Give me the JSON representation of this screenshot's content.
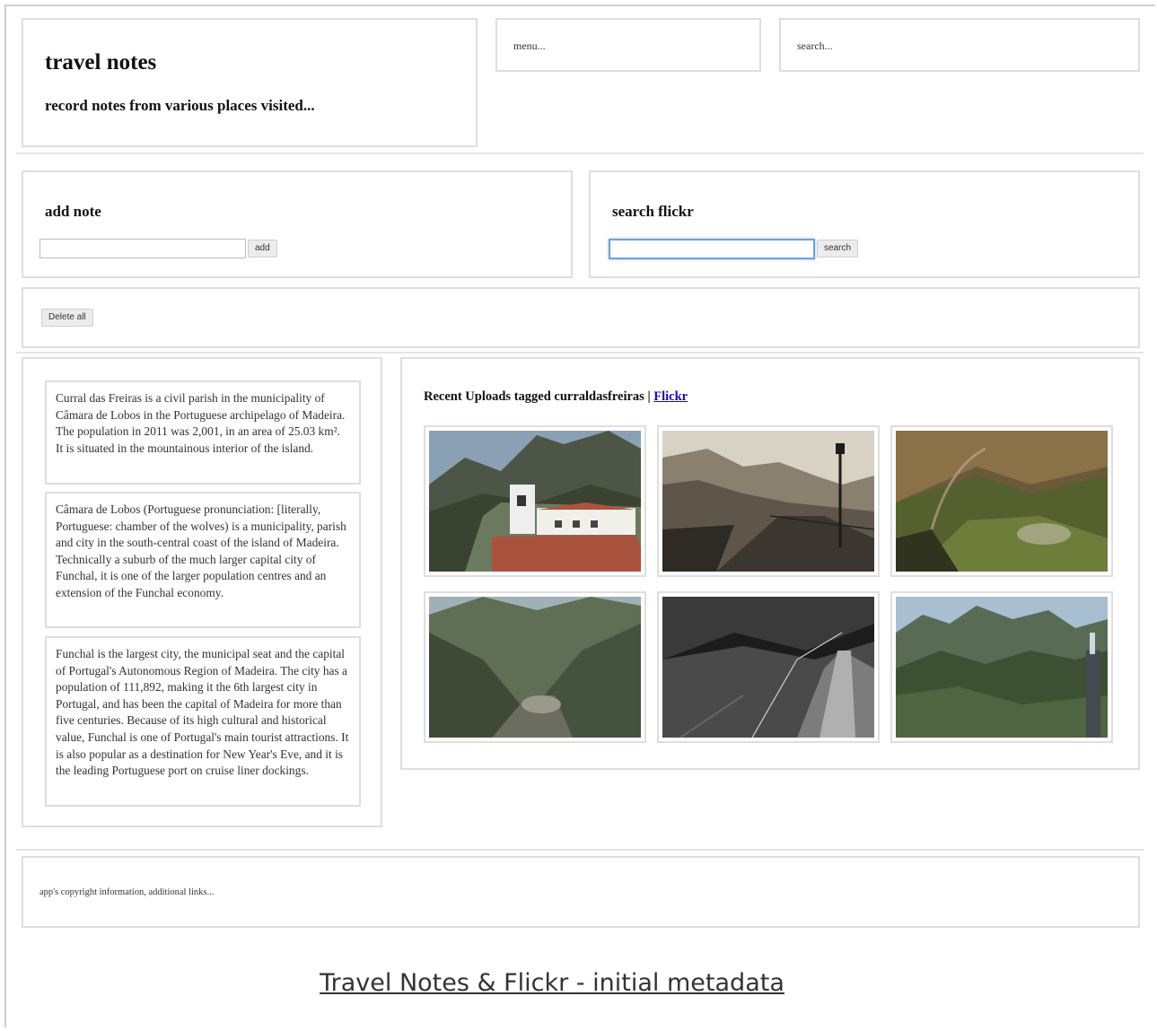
{
  "header": {
    "title": "travel notes",
    "subtitle": "record notes from various places visited...",
    "menu_text": "menu...",
    "search_text": "search..."
  },
  "add_note": {
    "heading": "add note",
    "input_value": "",
    "button_label": "add"
  },
  "search_flickr": {
    "heading": "search flickr",
    "input_value": "",
    "button_label": "search"
  },
  "controls": {
    "delete_all_label": "Delete all"
  },
  "notes": [
    {
      "text": "Curral das Freiras is a civil parish in the municipality of Câmara de Lobos in the Portuguese archipelago of Madeira. The population in 2011 was 2,001, in an area of 25.03 km². It is situated in the mountainous interior of the island."
    },
    {
      "text": "Câmara de Lobos (Portuguese pronunciation: [literally, Portuguese: chamber of the wolves) is a municipality, parish and city in the south-central coast of the island of Madeira. Technically a suburb of the much larger capital city of Funchal, it is one of the larger population centres and an extension of the Funchal economy."
    },
    {
      "text": "Funchal is the largest city, the municipal seat and the capital of Portugal's Autonomous Region of Madeira. The city has a population of 111,892, making it the 6th largest city in Portugal, and has been the capital of Madeira for more than five centuries. Because of its high cultural and historical value, Funchal is one of Portugal's main tourist attractions. It is also popular as a destination for New Year's Eve, and it is the leading Portuguese port on cruise liner dockings."
    }
  ],
  "flickr": {
    "heading_prefix": "Recent Uploads tagged curraldasfreiras",
    "separator": "|",
    "link_label": "Flickr",
    "photos": [
      {
        "icon": "photo-village-church"
      },
      {
        "icon": "photo-sepia-promenade"
      },
      {
        "icon": "photo-valley-rainbow"
      },
      {
        "icon": "photo-deep-valley"
      },
      {
        "icon": "photo-mountain-path-bw"
      },
      {
        "icon": "photo-mountain-ridge"
      }
    ]
  },
  "footer": {
    "text": "app's copyright information, additional links..."
  },
  "caption": "Travel Notes & Flickr - initial metadata",
  "colors": {
    "border": "#dedede",
    "link": "#1a0dab",
    "focus": "#6e9fe0"
  }
}
